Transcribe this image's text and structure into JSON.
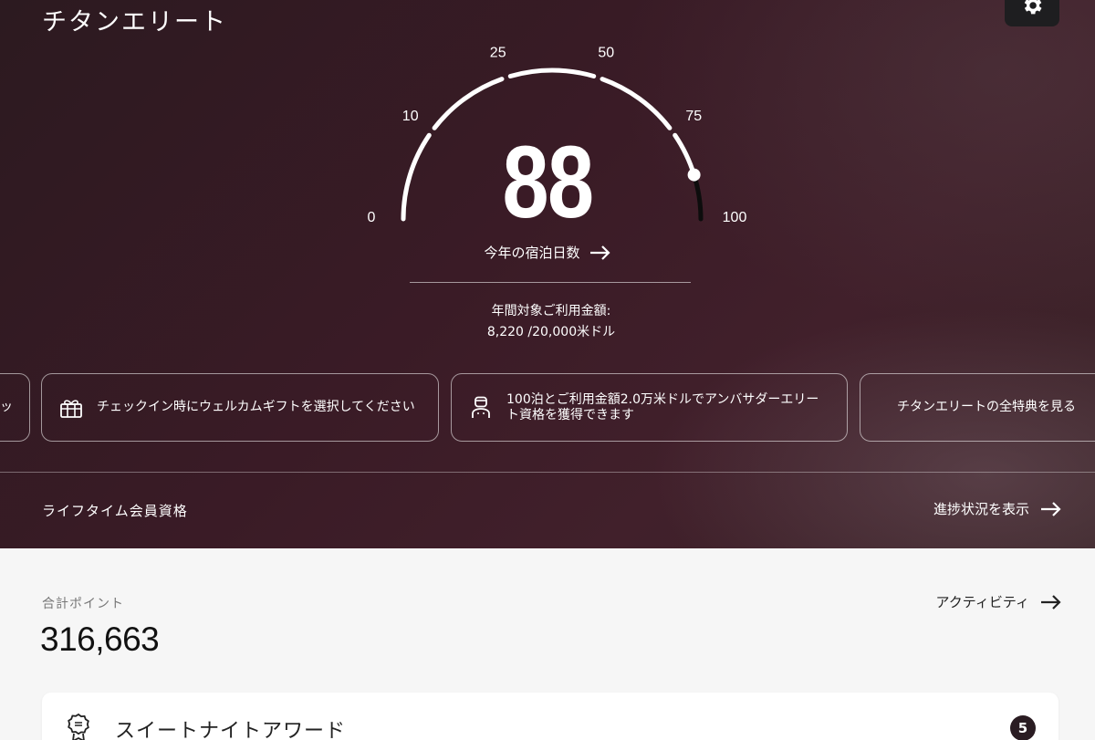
{
  "header": {
    "tier_title": "チタンエリート",
    "settings_icon": "gear-icon"
  },
  "gauge": {
    "value": 88,
    "value_display": "88",
    "min": 0,
    "max": 100,
    "tick_labels": [
      "0",
      "10",
      "25",
      "50",
      "75",
      "100"
    ],
    "nights_link_label": "今年の宿泊日数",
    "spend_label": "年間対象ご利用金額:",
    "spend_value": "8,220 /20,000米ドル"
  },
  "benefits": [
    {
      "icon": "gift-icon",
      "text": "チェックイン時にウェルカムギフトを選択してください"
    },
    {
      "icon": "ambassador-icon",
      "text": "100泊とご利用金額2.0万米ドルでアンバサダーエリート資格を獲得できます"
    },
    {
      "icon": "",
      "text": "チタンエリートの全特典を見る"
    }
  ],
  "lifetime": {
    "label": "ライフタイム会員資格",
    "progress_link": "進捗状況を表示"
  },
  "points": {
    "label": "合計ポイント",
    "value": "316,663",
    "activity_link": "アクティビティ"
  },
  "awards": [
    {
      "icon": "award-ribbon-icon",
      "label": "スイートナイトアワード",
      "count": "5"
    }
  ],
  "colors": {
    "hero_bg": "#3a1b26",
    "accent_dark": "#2a1c22",
    "page_bg": "#f6f6f6"
  }
}
